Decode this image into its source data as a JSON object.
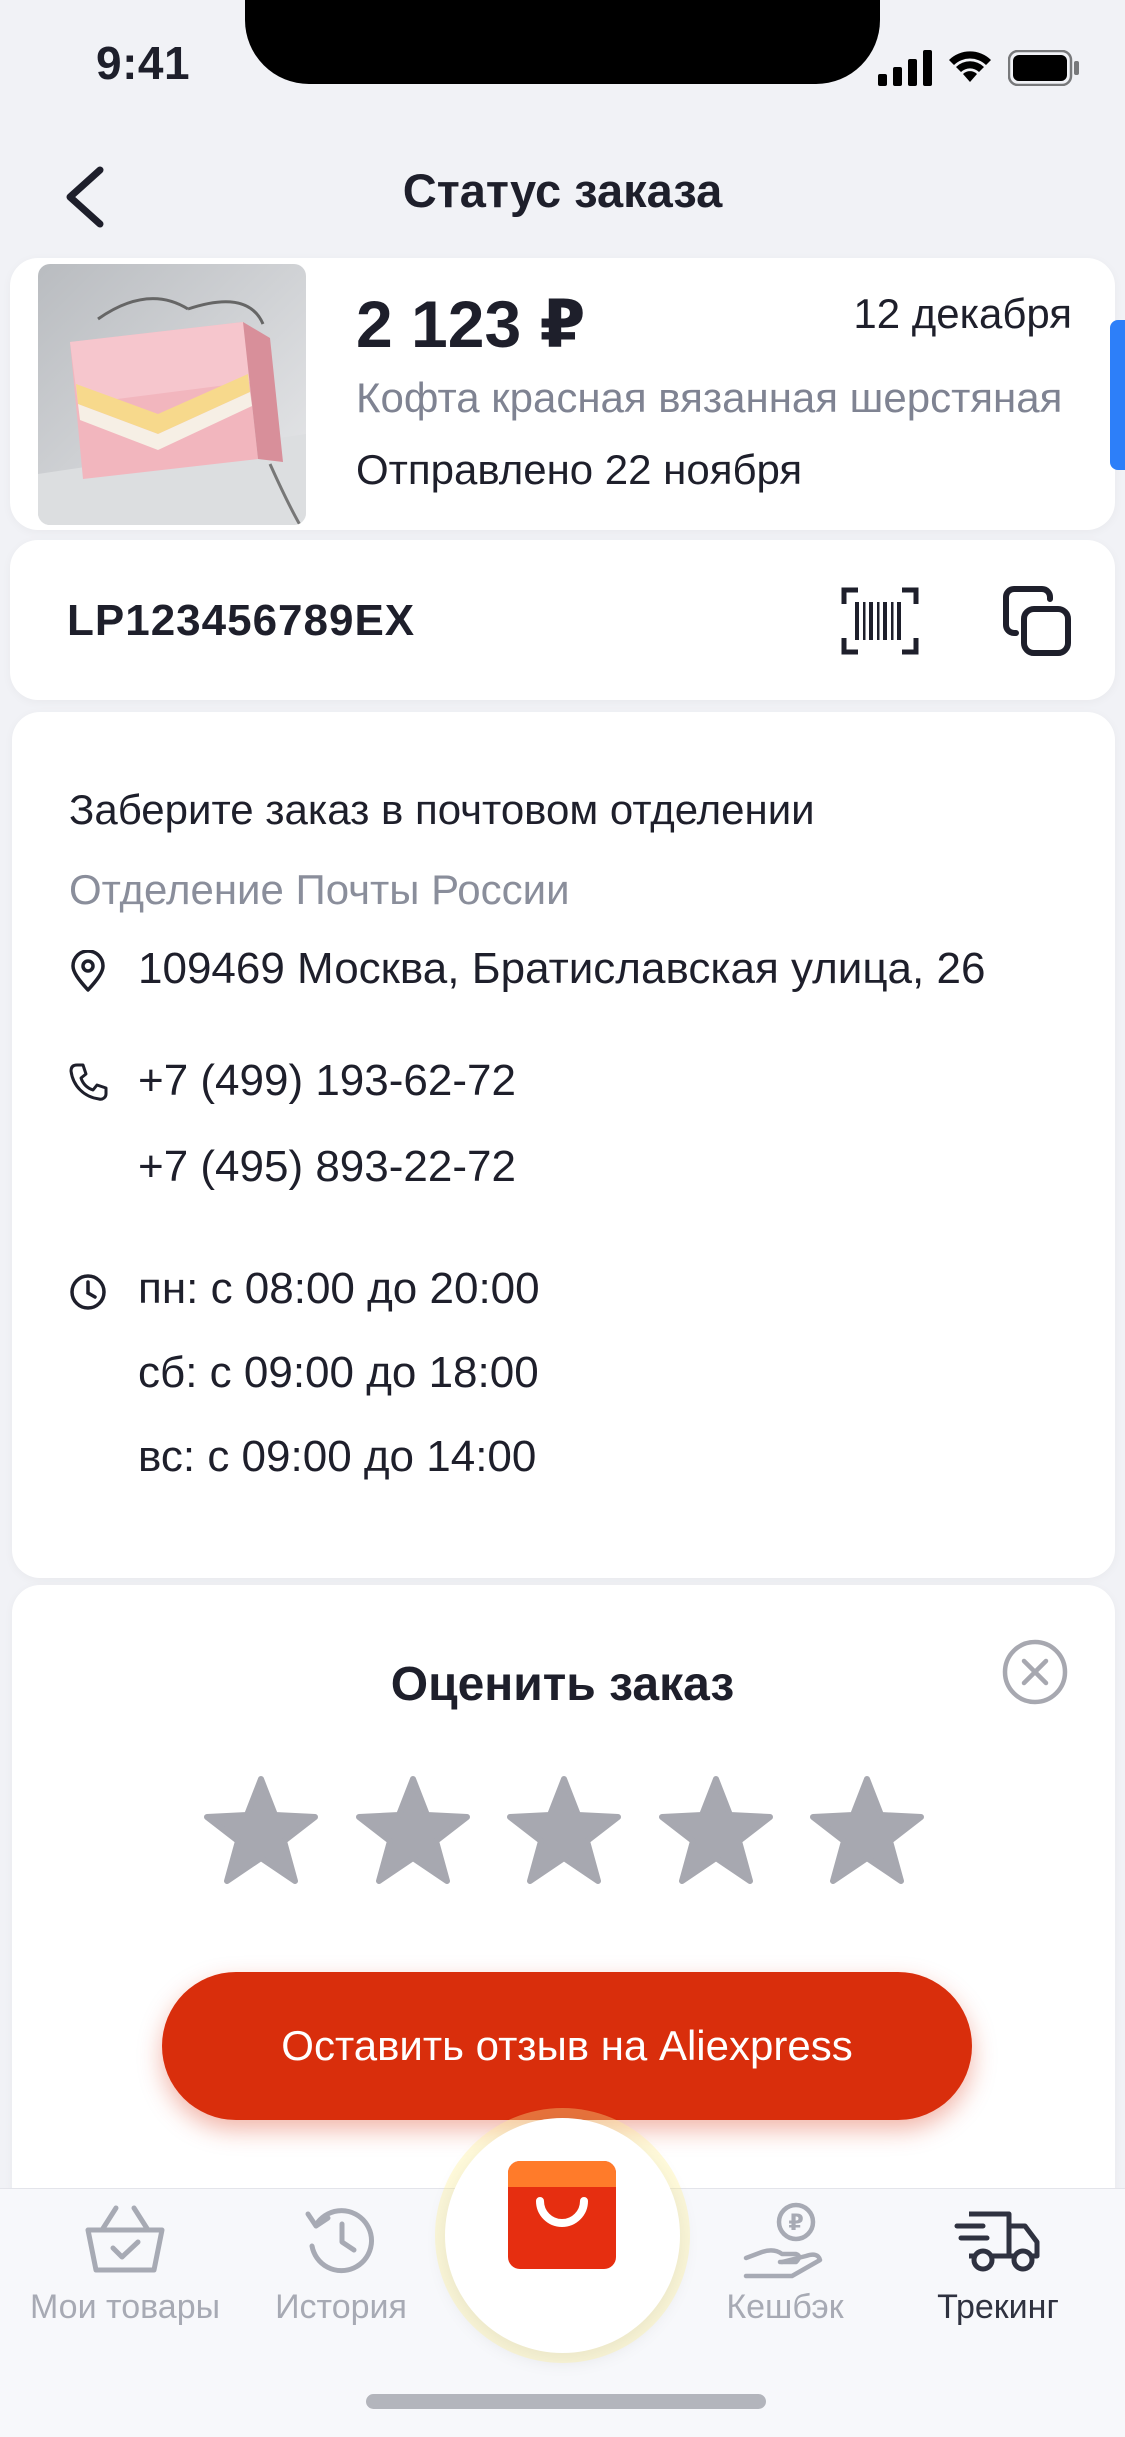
{
  "status_bar": {
    "time": "9:41"
  },
  "header": {
    "title": "Статус заказа"
  },
  "order": {
    "price": "2 123 ₽",
    "date": "12 декабря",
    "title": "Кофта красная вязанная шерстяная",
    "shipped": "Отправлено 22 ноября"
  },
  "tracking": {
    "number": "LP123456789EX"
  },
  "pickup": {
    "title": "Заберите заказ в почтовом отделении",
    "office": "Отделение Почты России",
    "address": "109469 Москва, Братиславская улица, 26",
    "phones": [
      "+7 (499) 193-62-72",
      "+7 (495) 893-22-72"
    ],
    "hours": [
      "пн: с 08:00 до 20:00",
      "сб: с 09:00 до 18:00",
      "вс: с 09:00 до 14:00"
    ]
  },
  "rating": {
    "title": "Оценить заказ",
    "stars_total": 5,
    "stars_selected": 0,
    "button_label": "Оставить отзыв на Aliexpress"
  },
  "tabbar": {
    "items": [
      {
        "label": "Мои товары",
        "icon": "basket-icon",
        "active": false
      },
      {
        "label": "История",
        "icon": "history-icon",
        "active": false
      },
      {
        "label": "",
        "icon": "aliexpress-bag-icon",
        "active": false
      },
      {
        "label": "Кешбэк",
        "icon": "cashback-icon",
        "active": false
      },
      {
        "label": "Трекинг",
        "icon": "truck-icon",
        "active": true
      }
    ]
  },
  "colors": {
    "accent_red": "#d92e0c",
    "text_primary": "#1e1f2b",
    "text_secondary": "#7f8392",
    "star_inactive": "#a7a8b0",
    "active_blue": "#2d7ff9"
  }
}
